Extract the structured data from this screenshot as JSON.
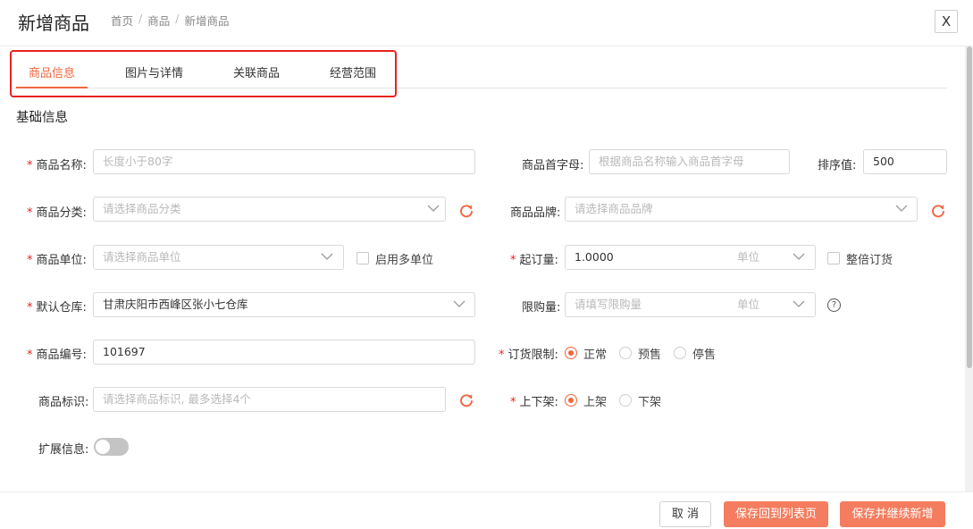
{
  "header": {
    "title": "新增商品",
    "breadcrumb": [
      "首页",
      "商品",
      "新增商品"
    ],
    "breadcrumb_sep": "/",
    "close_label": "X"
  },
  "tabs": [
    {
      "label": "商品信息",
      "active": true
    },
    {
      "label": "图片与详情",
      "active": false
    },
    {
      "label": "关联商品",
      "active": false
    },
    {
      "label": "经营范围",
      "active": false
    }
  ],
  "section_title": "基础信息",
  "required_mark": "*",
  "fields": {
    "name": {
      "label": "商品名称:",
      "placeholder": "长度小于80字"
    },
    "initials": {
      "label": "商品首字母:",
      "placeholder": "根据商品名称输入商品首字母"
    },
    "sort": {
      "label": "排序值:",
      "value": "500"
    },
    "category": {
      "label": "商品分类:",
      "placeholder": "请选择商品分类"
    },
    "brand": {
      "label": "商品品牌:",
      "placeholder": "请选择商品品牌"
    },
    "unit": {
      "label": "商品单位:",
      "placeholder": "请选择商品单位"
    },
    "multi_unit": {
      "label": "启用多单位",
      "checked": false
    },
    "moq": {
      "label": "起订量:",
      "value": "1.0000",
      "unit_placeholder": "单位"
    },
    "whole_order": {
      "label": "整倍订货",
      "checked": false
    },
    "warehouse": {
      "label": "默认仓库:",
      "value": "甘肃庆阳市西峰区张小七仓库"
    },
    "limit": {
      "label": "限购量:",
      "placeholder": "请填写限购量",
      "unit_placeholder": "单位",
      "help": "?"
    },
    "code": {
      "label": "商品编号:",
      "value": "101697"
    },
    "order_limit": {
      "label": "订货限制:",
      "options": [
        "正常",
        "预售",
        "停售"
      ],
      "selected": "正常"
    },
    "tags": {
      "label": "商品标识:",
      "placeholder": "请选择商品标识, 最多选择4个"
    },
    "shelf": {
      "label": "上下架:",
      "options": [
        "上架",
        "下架"
      ],
      "selected": "上架"
    },
    "extend": {
      "label": "扩展信息:",
      "enabled": false
    }
  },
  "footer": {
    "cancel": "取 消",
    "save_back": "保存回到列表页",
    "save_continue": "保存并继续新增"
  },
  "colors": {
    "accent": "#f0663e",
    "highlight_box": "#e8231f",
    "primary_button": "#f47d5f"
  }
}
